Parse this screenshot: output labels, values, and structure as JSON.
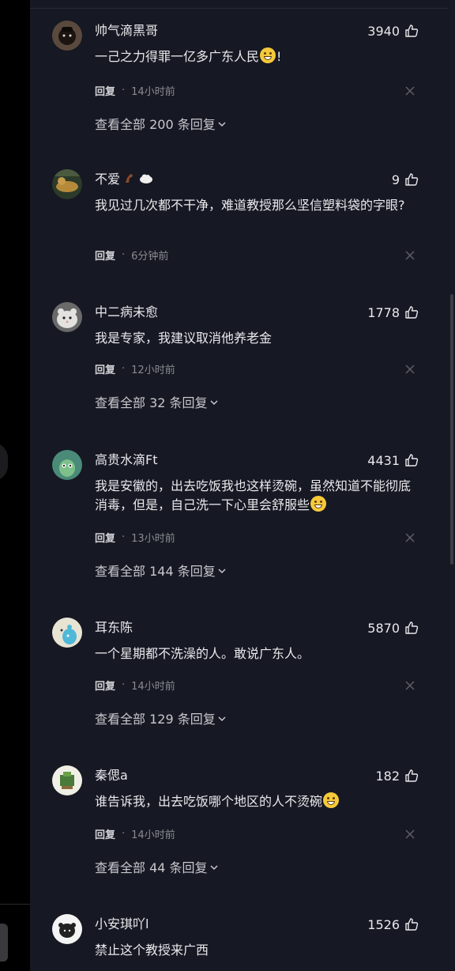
{
  "comments": [
    {
      "username": "帅气滴黑哥",
      "likes": "3940",
      "text": "一己之力得罪一亿多广东人民",
      "text_suffix": "!",
      "has_emoji": true,
      "reply_label": "回复",
      "time": "14小时前",
      "expand": "查看全部 200 条回复"
    },
    {
      "username": "不爱",
      "likes": "9",
      "text": "我见过几次都不干净，难道教授那么坚信塑料袋的字眼?",
      "reply_label": "回复",
      "time": "6分钟前"
    },
    {
      "username": "中二病未愈",
      "likes": "1778",
      "text": "我是专家，我建议取消他养老金",
      "reply_label": "回复",
      "time": "12小时前",
      "expand": "查看全部 32 条回复"
    },
    {
      "username": "高贵水滴Ft",
      "likes": "4431",
      "text": "我是安徽的，出去吃饭我也这样烫碗，虽然知道不能彻底消毒，但是，自己洗一下心里会舒服些",
      "has_emoji": true,
      "reply_label": "回复",
      "time": "13小时前",
      "expand": "查看全部 144 条回复"
    },
    {
      "username": "耳东陈",
      "likes": "5870",
      "text": "一个星期都不洗澡的人。敢说广东人。",
      "reply_label": "回复",
      "time": "14小时前",
      "expand": "查看全部 129 条回复"
    },
    {
      "username": "秦偲a",
      "likes": "182",
      "text": "谁告诉我，出去吃饭哪个地区的人不烫碗",
      "has_emoji": true,
      "reply_label": "回复",
      "time": "14小时前",
      "expand": "查看全部 44 条回复"
    },
    {
      "username": "小安琪吖l",
      "likes": "1526",
      "text": "禁止这个教授来广西"
    }
  ]
}
